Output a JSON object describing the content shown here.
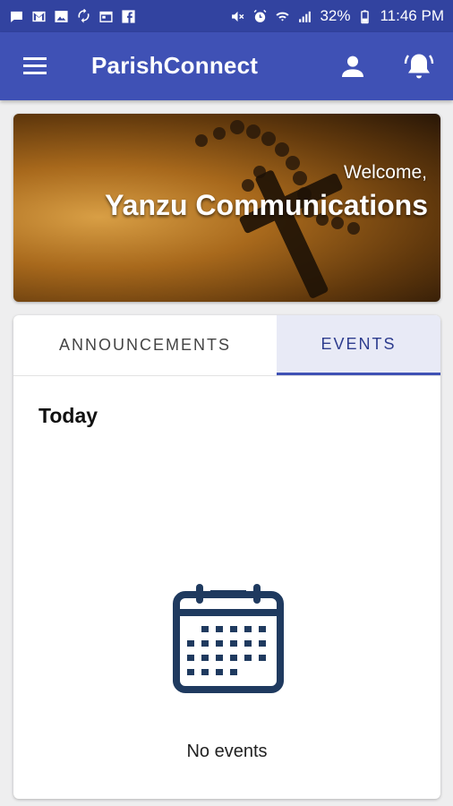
{
  "status_bar": {
    "battery_percent": "32%",
    "time": "11:46 PM",
    "left_icons": [
      "message-icon",
      "gmail-icon",
      "image-icon",
      "sync-icon",
      "calendar-small-icon",
      "facebook-icon"
    ],
    "right_icons": [
      "mute-icon",
      "alarm-icon",
      "wifi-icon",
      "signal-icon",
      "battery-icon"
    ]
  },
  "app_bar": {
    "title": "ParishConnect",
    "menu_icon": "menu-icon",
    "profile_icon": "person-icon",
    "notification_icon": "bell-icon"
  },
  "banner": {
    "welcome": "Welcome,",
    "name": "Yanzu Communications"
  },
  "tabs": [
    {
      "label": "ANNOUNCEMENTS",
      "active": false
    },
    {
      "label": "EVENTS",
      "active": true
    }
  ],
  "events_panel": {
    "heading": "Today",
    "empty_icon": "calendar-icon",
    "empty_text": "No events"
  },
  "colors": {
    "status_bar": "#3243a0",
    "app_bar": "#3f51b5",
    "active_tab_bg": "#e8eaf6",
    "active_tab_text": "#2d3c8e",
    "calendar_icon": "#1f3a5f"
  }
}
